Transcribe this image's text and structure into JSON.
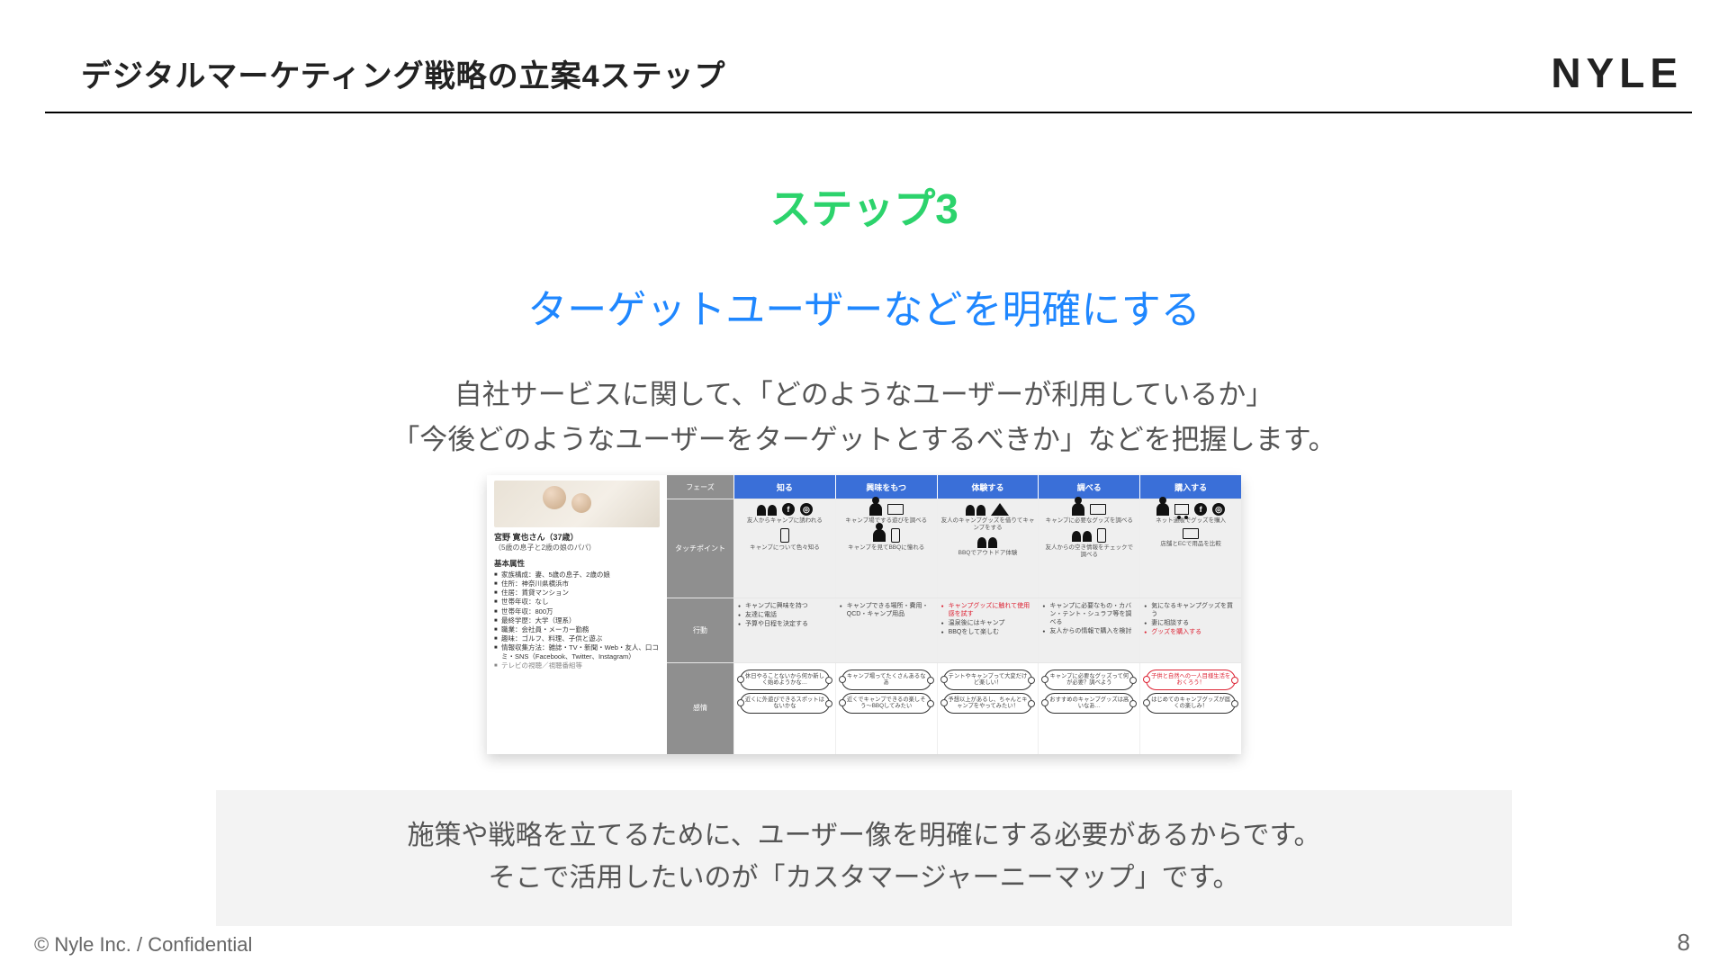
{
  "header": {
    "title": "デジタルマーケティング戦略の立案4ステップ",
    "logo": "NYLE"
  },
  "step": {
    "label": "ステップ3",
    "title": "ターゲットユーザーなどを明確にする",
    "lead_l1": "自社サービスに関して、「どのようなユーザーが利用しているか」",
    "lead_l2": "「今後どのようなユーザーをターゲットとするべきか」などを把握します。"
  },
  "journey": {
    "persona": {
      "name": "宮野 寛也さん（37歳）",
      "sub": "（5歳の息子と2歳の娘のパパ）",
      "section": "基本属性",
      "attrs": [
        "家族構成：妻、5歳の息子、2歳の娘",
        "住所：神奈川県横浜市",
        "住居：賃貸マンション",
        "世帯年収：なし",
        "世帯年収：800万",
        "最終学歴：大学（理系）",
        "職業：会社員・メーカー勤務",
        "趣味：ゴルフ、料理、子供と遊ぶ",
        "情報収集方法：雑誌・TV・新聞・Web・友人、口コミ・SNS（Facebook、Twitter、Instagram）",
        "テレビの視聴／視聴番組等"
      ]
    },
    "corner_label": "フェーズ",
    "phases": [
      "知る",
      "興味をもつ",
      "体験する",
      "調べる",
      "購入する"
    ],
    "row_labels": {
      "touch": "タッチポイント",
      "action": "行動",
      "emotion": "感情"
    },
    "touch_notes": [
      "友人からキャンプに誘われる",
      "キャンプ場でする遊びを調べる",
      "友人のキャンプグッズを借りてキャンプをする",
      "キャンプに必要なグッズを調べる",
      "ネット通販でグッズを購入"
    ],
    "touch_notes2": [
      "キャンプについて色々知る",
      "キャンプを見てBBQに憧れる",
      "BBQでアウトドア体験",
      "友人からの空き情報をチェックで調べる",
      "店舗とECで用品を比較"
    ],
    "actions": [
      [
        "キャンプに興味を持つ",
        "友達に電話",
        "予算や日程を決定する"
      ],
      [
        "キャンプできる場所・費用・QCD・キャンプ用品"
      ],
      [
        "キャンプグッズに触れて使用感を試す",
        "温泉後にはキャンプ",
        "BBQをして楽しむ"
      ],
      [
        "キャンプに必要なもの・カバン・テント・シュラフ等を調べる",
        "友人からの情報で購入を検討"
      ],
      [
        "気になるキャンプグッズを買う",
        "妻に相談する",
        "グッズを購入する"
      ]
    ],
    "emotions": [
      [
        "休日やることないから何か新しく始めようかな…",
        "近くに外遊びできるスポットはないかな"
      ],
      [
        "キャンプ場ってたくさんあるなあ",
        "近くでキャンプできるの楽しそう〜BBQしてみたい"
      ],
      [
        "テントやキャンプって大変だけど楽しい！",
        "予想以上があるし、ちゃんとキャンプをやってみたい！"
      ],
      [
        "キャンプに必要なグッズって何が必要？調べよう",
        "おすすめのキャンプグッズは高いなあ…"
      ],
      [
        "子供と自然への一人目様生活をおくろう！",
        "はじめてのキャンプグッズが届くの楽しみ！"
      ]
    ],
    "social_label_f": "f",
    "social_label_ig": "◎"
  },
  "callout": {
    "l1": "施策や戦略を立てるために、ユーザー像を明確にする必要があるからです。",
    "l2": "そこで活用したいのが「カスタマージャーニーマップ」です。"
  },
  "footer": {
    "left": "© Nyle Inc. / Confidential",
    "page": "8"
  }
}
